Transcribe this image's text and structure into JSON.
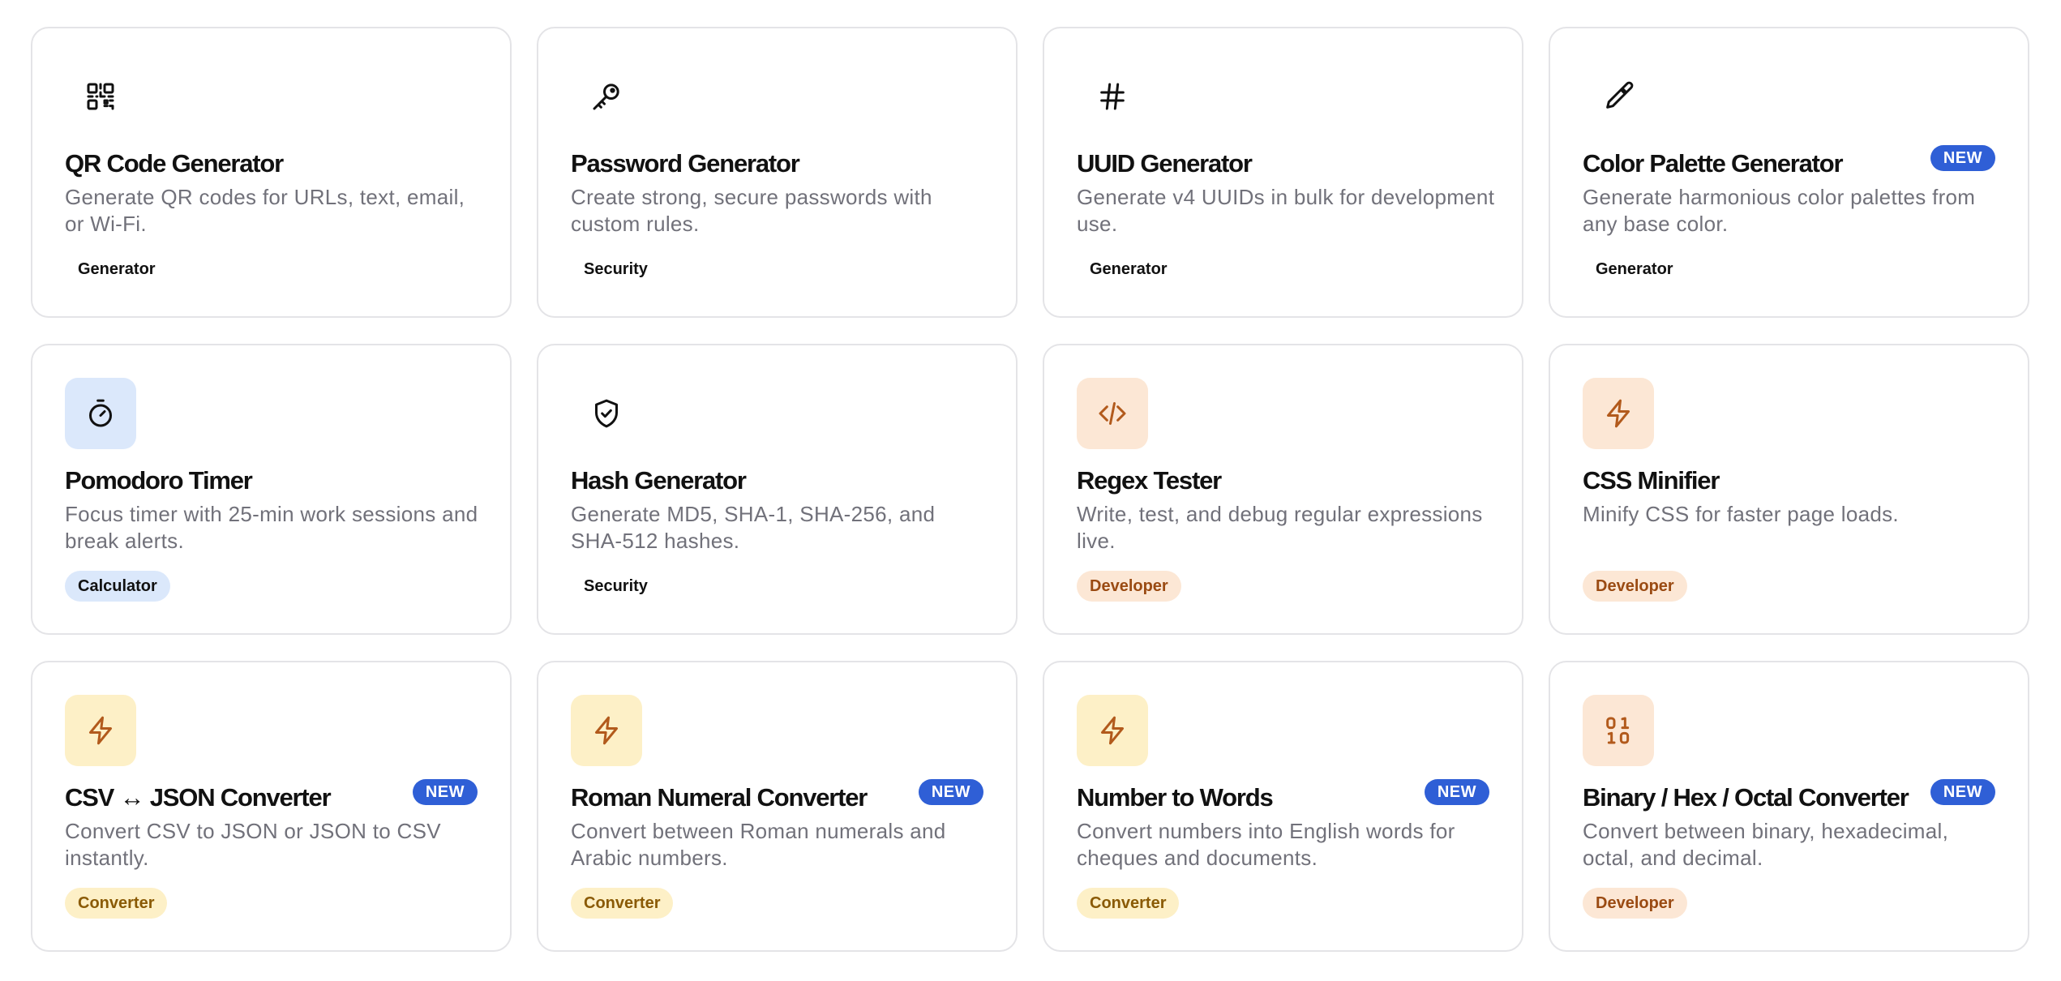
{
  "cards": [
    {
      "title": "QR Code Generator",
      "description": "Generate QR codes for URLs, text, email, or Wi-Fi.",
      "tag": "Generator",
      "icon": "qr-code-icon",
      "new": false
    },
    {
      "title": "Password Generator",
      "description": "Create strong, secure passwords with custom rules.",
      "tag": "Security",
      "icon": "key-icon",
      "new": false
    },
    {
      "title": "UUID Generator",
      "description": "Generate v4 UUIDs in bulk for development use.",
      "tag": "Generator",
      "icon": "hash-icon",
      "new": false
    },
    {
      "title": "Color Palette Generator",
      "description": "Generate harmonious color palettes from any base color.",
      "tag": "Generator",
      "icon": "eyedropper-icon",
      "new": true,
      "badge": "NEW"
    },
    {
      "title": "Pomodoro Timer",
      "description": "Focus timer with 25-min work sessions and break alerts.",
      "tag": "Calculator",
      "icon": "timer-icon",
      "new": false
    },
    {
      "title": "Hash Generator",
      "description": "Generate MD5, SHA-1, SHA-256, and SHA-512 hashes.",
      "tag": "Security",
      "icon": "shield-check-icon",
      "new": false
    },
    {
      "title": "Regex Tester",
      "description": "Write, test, and debug regular expressions live.",
      "tag": "Developer",
      "icon": "code-icon",
      "new": false
    },
    {
      "title": "CSS Minifier",
      "description": "Minify CSS for faster page loads.",
      "tag": "Developer",
      "icon": "lightning-icon",
      "new": false
    },
    {
      "title": "CSV ↔ JSON Converter",
      "description": "Convert CSV to JSON or JSON to CSV instantly.",
      "tag": "Converter",
      "icon": "lightning-icon",
      "new": true,
      "badge": "NEW"
    },
    {
      "title": "Roman Numeral Converter",
      "description": "Convert between Roman numerals and Arabic numbers.",
      "tag": "Converter",
      "icon": "lightning-icon",
      "new": true,
      "badge": "NEW"
    },
    {
      "title": "Number to Words",
      "description": "Convert numbers into English words for cheques and documents.",
      "tag": "Converter",
      "icon": "lightning-icon",
      "new": true,
      "badge": "NEW"
    },
    {
      "title": "Binary / Hex / Octal Converter",
      "description": "Convert between binary, hexadecimal, octal, and decimal.",
      "tag": "Developer",
      "icon": "binary-icon",
      "new": true,
      "badge": "NEW"
    }
  ],
  "colors": {
    "new_badge": "#2f5fd6",
    "developer_tag_bg": "#fce7d5",
    "developer_tag_text": "#9a4a12",
    "converter_tag_bg": "#fdf0c7",
    "converter_tag_text": "#8a5a05",
    "calculator_tag_bg": "#dbe8fb",
    "icon_orange": "#b25a1c",
    "icon_dark": "#111111"
  }
}
